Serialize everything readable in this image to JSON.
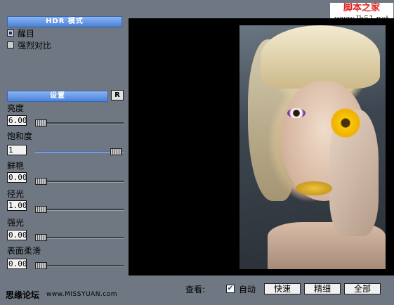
{
  "watermark": {
    "site_name": "脚本之家",
    "site_url": "www.Jb51.net"
  },
  "hdr_mode": {
    "title": "HDR 模式",
    "options": [
      {
        "label": "醒目",
        "selected": true
      },
      {
        "label": "强烈对比",
        "selected": false
      }
    ]
  },
  "settings": {
    "title": "设置",
    "reset_label": "R",
    "params": [
      {
        "label": "亮度",
        "value": "6.00",
        "level": 0.0
      },
      {
        "label": "饱和度",
        "value": "1",
        "level": 1.0
      },
      {
        "label": "鲜艳",
        "value": "0.00",
        "level": 0.0
      },
      {
        "label": "径光",
        "value": "1.00",
        "level": 0.0
      },
      {
        "label": "强光",
        "value": "0.00",
        "level": 0.0
      },
      {
        "label": "表面柔滑",
        "value": "0.00",
        "level": 0.0
      }
    ]
  },
  "bottom": {
    "view_label": "查看:",
    "auto_label": "自动",
    "auto_checked": true,
    "buttons": [
      "快速",
      "精细",
      "全部"
    ]
  },
  "footer": {
    "forum": "思缘论坛",
    "url": "www.MISSYUAN.com"
  },
  "colors": {
    "panel": "#6f7782",
    "section": "#4a82d8",
    "preview_bg": "#000000"
  }
}
